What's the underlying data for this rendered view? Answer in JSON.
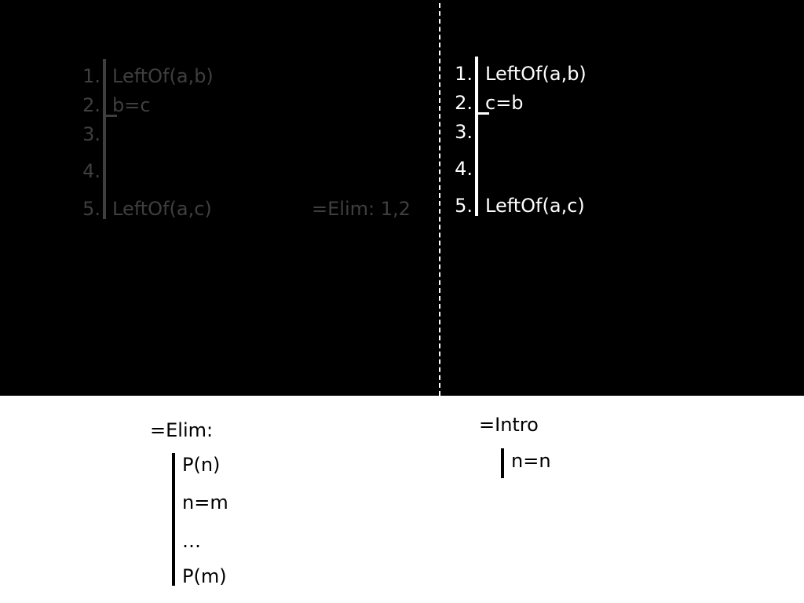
{
  "left_proof": {
    "line_numbers": [
      "1.",
      "2.",
      "3.",
      "4.",
      "5."
    ],
    "premise_1": "LeftOf(a,b)",
    "premise_2": "b=c",
    "conclusion": "LeftOf(a,c)",
    "justification": "=Elim: 1,2"
  },
  "right_proof": {
    "line_numbers": [
      "1.",
      "2.",
      "3.",
      "4.",
      "5."
    ],
    "premise_1": "LeftOf(a,b)",
    "premise_2": "c=b",
    "conclusion": "LeftOf(a,c)"
  },
  "elim_rule": {
    "title": "=Elim:",
    "lines": [
      "P(n)",
      "n=m",
      "…",
      "P(m)"
    ]
  },
  "intro_rule": {
    "title": "=Intro",
    "line": "n=n"
  },
  "colors": {
    "dim_text": "#3f3f3f",
    "bright_text": "#ffffff",
    "background_top": "#000000",
    "background_bottom": "#ffffff"
  }
}
